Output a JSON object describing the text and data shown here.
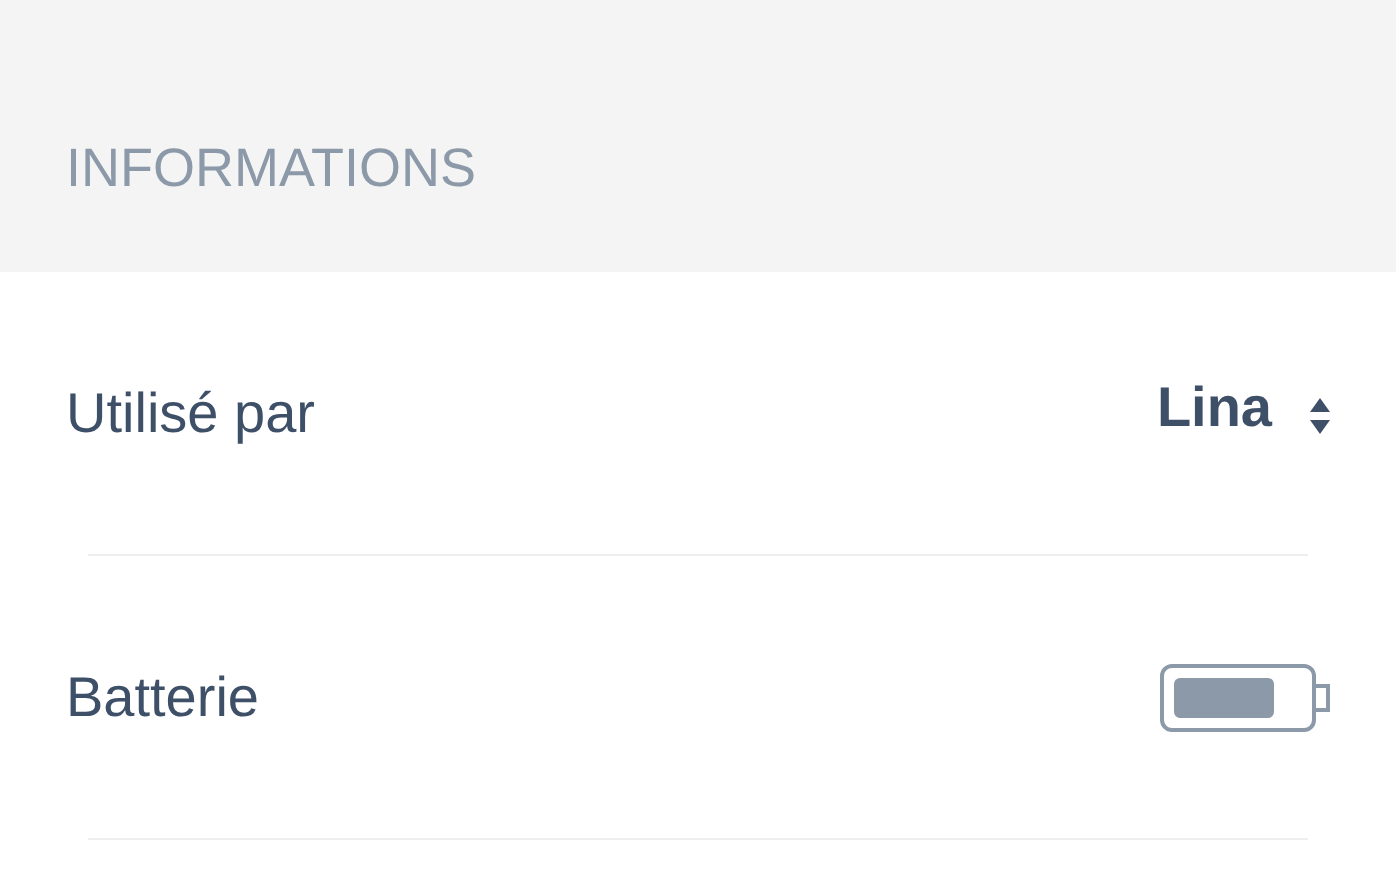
{
  "section_header": "INFORMATIONS",
  "rows": [
    {
      "kind": "select",
      "label": "Utilisé par",
      "value": "Lina"
    },
    {
      "kind": "battery",
      "label": "Batterie"
    }
  ]
}
